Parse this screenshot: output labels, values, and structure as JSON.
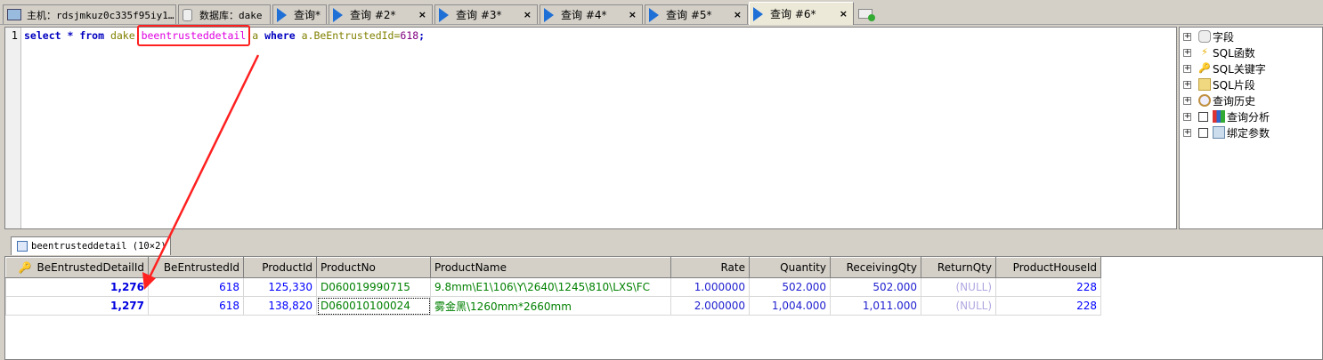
{
  "tabs": [
    {
      "label": "主机：rdsjmkuz0c335f95iy1…",
      "icon": "server-icon"
    },
    {
      "label": "数据库：dake",
      "icon": "database-icon"
    },
    {
      "label": "查询*",
      "icon": "play-icon"
    },
    {
      "label": "查询 #2*",
      "icon": "play-icon"
    },
    {
      "label": "查询 #3*",
      "icon": "play-icon"
    },
    {
      "label": "查询 #4*",
      "icon": "play-icon"
    },
    {
      "label": "查询 #5*",
      "icon": "play-icon"
    },
    {
      "label": "查询 #6*",
      "icon": "play-icon",
      "active": true
    }
  ],
  "close_label": "×",
  "editor": {
    "line_number": "1",
    "sql": {
      "select": "select",
      "star": " * ",
      "from": "from",
      "db": " dake ",
      "table": "beentrusteddetail",
      "alias": " a ",
      "where": "where",
      "cond": " a.BeEntrustedId=",
      "value": "618",
      ";": ";"
    }
  },
  "tree": [
    {
      "label": "字段",
      "icon": "field-icon"
    },
    {
      "label": "SQL函数",
      "icon": "lightning-icon"
    },
    {
      "label": "SQL关键字",
      "icon": "key-icon"
    },
    {
      "label": "SQL片段",
      "icon": "folder-icon"
    },
    {
      "label": "查询历史",
      "icon": "clock-icon"
    },
    {
      "label": "查询分析",
      "icon": "chart-icon",
      "checkbox": true
    },
    {
      "label": "绑定参数",
      "icon": "params-icon",
      "checkbox": true
    }
  ],
  "result_tab": "beentrusteddetail (10×2)",
  "grid": {
    "columns": [
      "BeEntrustedDetailId",
      "BeEntrustedId",
      "ProductId",
      "ProductNo",
      "ProductName",
      "Rate",
      "Quantity",
      "ReceivingQty",
      "ReturnQty",
      "ProductHouseId"
    ],
    "rows": [
      [
        "1,276",
        "618",
        "125,330",
        "D060019990715",
        "9.8mm\\E1\\106\\Y\\2640\\1245\\810\\LXS\\FC",
        "1.000000",
        "502.000",
        "502.000",
        "(NULL)",
        "228"
      ],
      [
        "1,277",
        "618",
        "138,820",
        "D060010100024",
        "雾金黑\\1260mm*2660mm",
        "2.000000",
        "1,004.000",
        "1,011.000",
        "(NULL)",
        "228"
      ]
    ]
  },
  "colors": {
    "annotation": "#ff2020",
    "keyword": "#0000c0",
    "highlight": "#e000e0"
  }
}
